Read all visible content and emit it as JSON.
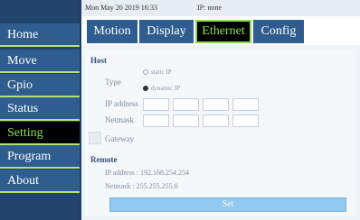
{
  "sidebar": {
    "items": [
      {
        "label": "Home"
      },
      {
        "label": "Move"
      },
      {
        "label": "Gpio"
      },
      {
        "label": "Status"
      },
      {
        "label": "Setting"
      },
      {
        "label": "Program"
      },
      {
        "label": "About"
      }
    ],
    "active_index": 4
  },
  "status": {
    "datetime": "Mon May 20 2019 16:33",
    "ip": "IP: none"
  },
  "tabs": [
    {
      "label": "Motion"
    },
    {
      "label": "Display"
    },
    {
      "label": "Ethernet"
    },
    {
      "label": "Config"
    }
  ],
  "host": {
    "title": "Host",
    "type_label": "Type",
    "options": [
      {
        "label": "static IP",
        "checked": false
      },
      {
        "label": "dynamic IP",
        "checked": true
      }
    ],
    "ip_label": "IP address",
    "netmask_label": "Netmask",
    "gateway_label": "Gateway"
  },
  "remote": {
    "title": "Remote",
    "ip_line": "IP address :  192.168.254.254",
    "netmask_line": "Netmask :   255.255.255.0"
  },
  "set_label": "Set",
  "colors": {
    "accent_green": "#8be04a",
    "tab_blue": "#2f5d8f",
    "button_blue": "#8fc8f0"
  }
}
